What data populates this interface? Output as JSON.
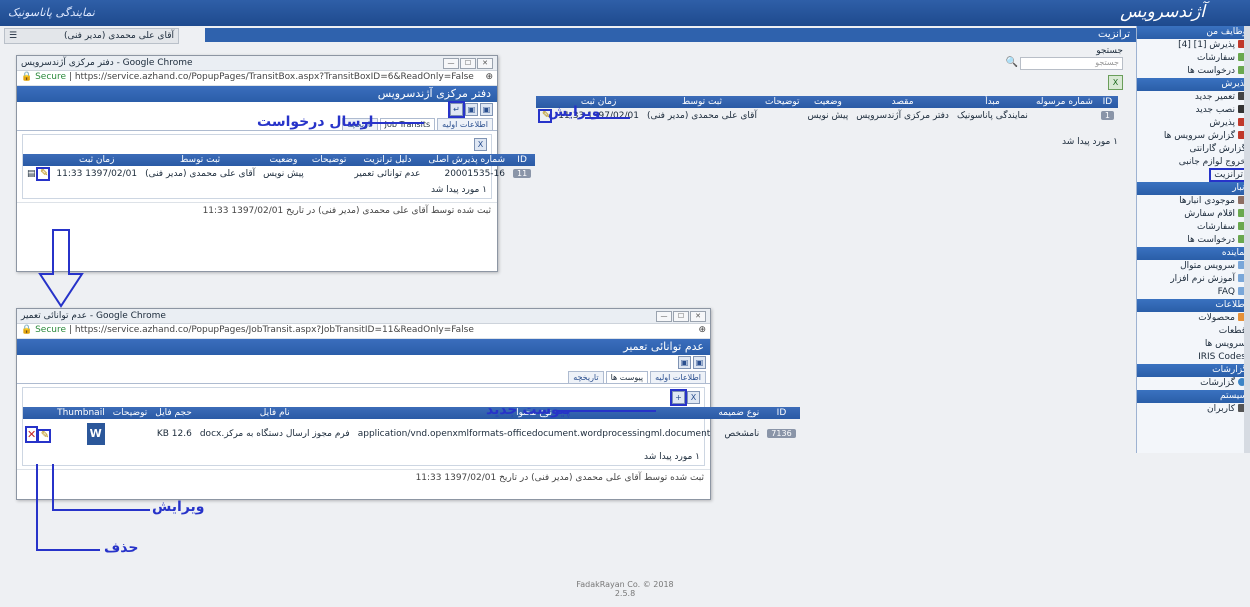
{
  "header": {
    "brand_right": "آژندسرویس",
    "brand_left": "نمایندگی پاناسونیک",
    "user_label": "آقای علی محمدی (مدیر فنی)",
    "menu_icon": "hamburger-icon",
    "page_title": "ترانزیت"
  },
  "sidebar": {
    "sections": [
      {
        "title": "وظایف من",
        "items": [
          "پذیرش [1] [4]",
          "سفارشات",
          "درخواست ها"
        ]
      },
      {
        "title": "پذیرش",
        "items": [
          "تعمیر جدید",
          "نصب جدید",
          "پذیرش",
          "گزارش سرویس ها",
          "گزارش گارانتی",
          "خروج لوازم جانبی",
          "ترانزیت"
        ]
      },
      {
        "title": "انبار",
        "items": [
          "موجودی انبارها",
          "اقلام سفارش",
          "سفارشات",
          "درخواست ها"
        ]
      },
      {
        "title": "نماینده",
        "items": [
          "سرویس متوال",
          "آموزش نرم افزار",
          "FAQ"
        ]
      },
      {
        "title": "اطلاعات",
        "items": [
          "محصولات",
          "قطعات",
          "سرویس ها",
          "IRIS Codes"
        ]
      },
      {
        "title": "گزارشات",
        "items": [
          "گزارشات"
        ]
      },
      {
        "title": "سیستم",
        "items": [
          "کاربران"
        ]
      }
    ]
  },
  "search": {
    "label": "جستجو",
    "placeholder": "جستجو"
  },
  "main_grid": {
    "headers": [
      "ID",
      "شماره مرسوله",
      "مبدأ",
      "مقصد",
      "وضعیت",
      "توضیحات",
      "ثبت توسط",
      "زمان ثبت"
    ],
    "row": {
      "id": "1",
      "origin": "نمایندگی پاناسونیک",
      "dest": "دفتر مرکزی آژندسرویس",
      "status": "پیش نویس",
      "by": "آقای علی محمدی (مدیر فنی)",
      "time": "1397/02/01 11:33"
    },
    "found": "۱ مورد پیدا شد"
  },
  "annotations": {
    "edit": "ویرایش",
    "send_request": "ارسال درخواست",
    "new_attachment": "پیوست جدید",
    "edit2": "ویرایش",
    "delete": "حذف"
  },
  "popup1": {
    "window_title": "دفتر مرکزی آژندسرویس - Google Chrome",
    "secure": "Secure",
    "url": "https://service.azhand.co/PopupPages/TransitBox.aspx?TransitBoxID=6&ReadOnly=False",
    "title": "دفتر مرکزی آژندسرویس",
    "tabs": [
      "اطلاعات اولیه",
      "Job Transits",
      "تاریخچه"
    ],
    "headers": [
      "ID",
      "شماره پذیرش اصلی",
      "دلیل ترانزیت",
      "توضیحات",
      "وضعیت",
      "ثبت توسط",
      "زمان ثبت"
    ],
    "row": {
      "id": "11",
      "job": "20001535-16",
      "reason": "عدم توانائی تعمیر",
      "status": "پیش نویس",
      "by": "آقای علی محمدی (مدیر فنی)",
      "time": "1397/02/01 11:33"
    },
    "found": "۱ مورد پیدا شد",
    "footnote": "ثبت شده توسط آقای علی محمدی (مدیر فنی) در تاریخ 1397/02/01 11:33"
  },
  "popup2": {
    "window_title": "عدم توانائی تعمیر - Google Chrome",
    "secure": "Secure",
    "url": "https://service.azhand.co/PopupPages/JobTransit.aspx?JobTransitID=11&ReadOnly=False",
    "title": "عدم توانائی تعمیر",
    "tabs": [
      "اطلاعات اولیه",
      "پیوست ها",
      "تاریخچه"
    ],
    "headers": [
      "ID",
      "نوع ضمیمه",
      "نوع محتوا",
      "نام فایل",
      "حجم فایل",
      "توضیحات",
      "Thumbnail"
    ],
    "row": {
      "id": "7136",
      "kind": "نامشخص",
      "mime": "application/vnd.openxmlformats-officedocument.wordprocessingml.document",
      "file": "فرم مجوز ارسال دستگاه به مرکز.docx",
      "size": "12.6 KB"
    },
    "found": "۱ مورد پیدا شد",
    "footnote": "ثبت شده توسط آقای علی محمدی (مدیر فنی) در تاریخ 1397/02/01 11:33"
  },
  "footer": {
    "copyright": "FadakRayan Co. © 2018",
    "version": "2.5.8"
  }
}
